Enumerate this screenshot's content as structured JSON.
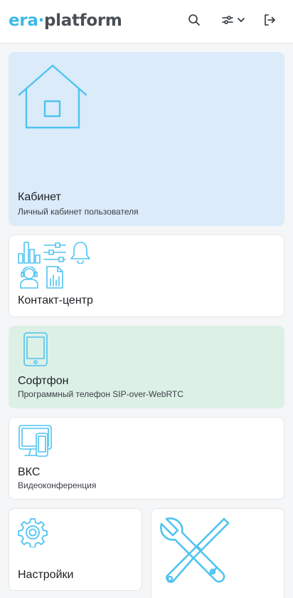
{
  "header": {
    "logo_left": "era",
    "logo_dot": "·",
    "logo_right": "platform",
    "icons": [
      "search-icon",
      "sliders-icon",
      "chevron-down-icon",
      "logout-icon"
    ]
  },
  "cards": {
    "cabinet": {
      "title": "Кабинет",
      "subtitle": "Личный кабинет пользователя",
      "icon": "house-icon"
    },
    "contact_center": {
      "title": "Контакт-центр",
      "icons": [
        "bar-chart-icon",
        "sliders-icon",
        "bell-icon",
        "operator-icon",
        "report-icon"
      ]
    },
    "softphone": {
      "title": "Софтфон",
      "subtitle": "Программный телефон SIP-over-WebRTC",
      "icon": "smartphone-icon"
    },
    "vks": {
      "title": "ВКС",
      "subtitle": "Видеоконференция",
      "icon": "devices-icon"
    },
    "settings": {
      "title": "Настройки",
      "icon": "gear-icon"
    },
    "tools": {
      "title": "",
      "icon": "tools-icon"
    }
  },
  "colors": {
    "accent": "#4fc3f0",
    "blue_card": "#dbebfa",
    "green_card": "#ddf0e6"
  }
}
